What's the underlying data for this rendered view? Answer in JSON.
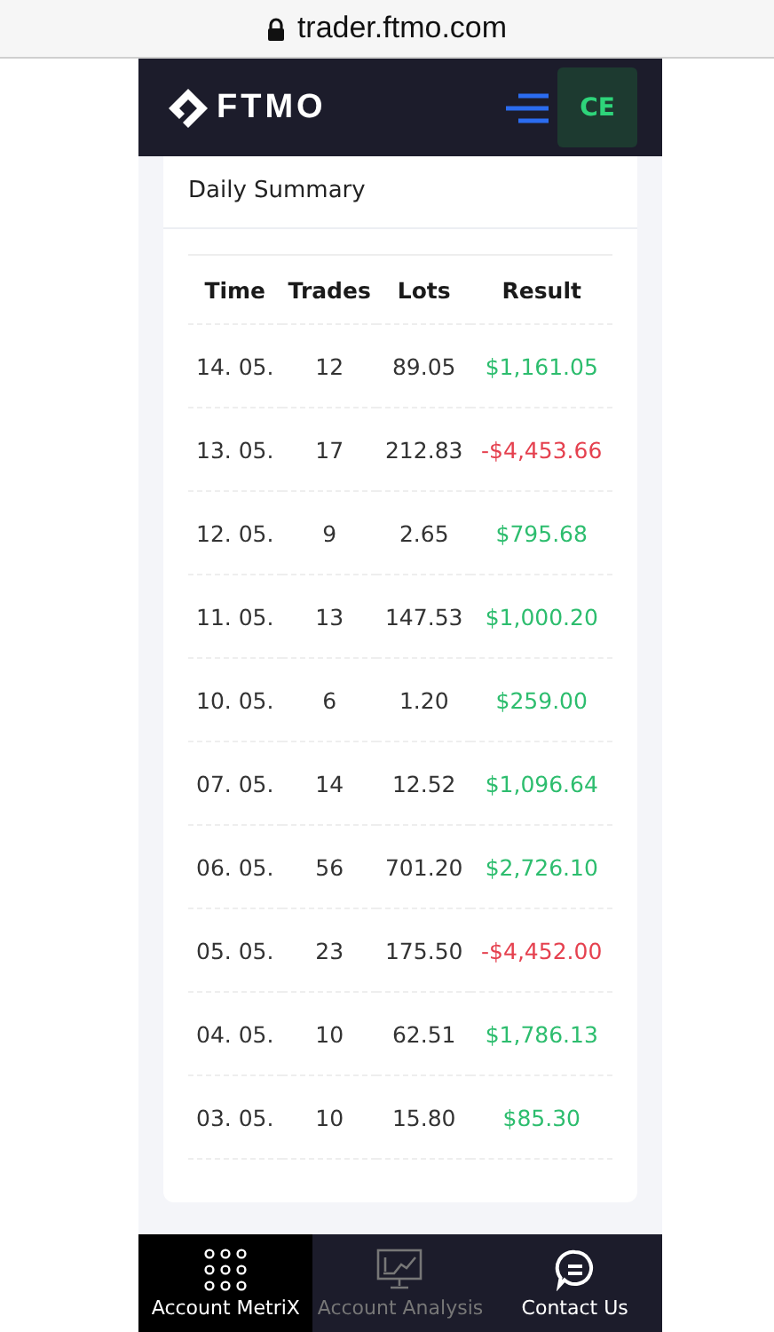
{
  "browser": {
    "url": "trader.ftmo.com"
  },
  "header": {
    "logo": "FTMO",
    "avatar": "CE"
  },
  "card": {
    "title": "Daily Summary",
    "columns": [
      "Time",
      "Trades",
      "Lots",
      "Result"
    ],
    "rows": [
      {
        "time": "14. 05.",
        "trades": "12",
        "lots": "89.05",
        "result": "$1,161.05",
        "negative": false
      },
      {
        "time": "13. 05.",
        "trades": "17",
        "lots": "212.83",
        "result": "-$4,453.66",
        "negative": true
      },
      {
        "time": "12. 05.",
        "trades": "9",
        "lots": "2.65",
        "result": "$795.68",
        "negative": false
      },
      {
        "time": "11. 05.",
        "trades": "13",
        "lots": "147.53",
        "result": "$1,000.20",
        "negative": false
      },
      {
        "time": "10. 05.",
        "trades": "6",
        "lots": "1.20",
        "result": "$259.00",
        "negative": false
      },
      {
        "time": "07. 05.",
        "trades": "14",
        "lots": "12.52",
        "result": "$1,096.64",
        "negative": false
      },
      {
        "time": "06. 05.",
        "trades": "56",
        "lots": "701.20",
        "result": "$2,726.10",
        "negative": false
      },
      {
        "time": "05. 05.",
        "trades": "23",
        "lots": "175.50",
        "result": "-$4,452.00",
        "negative": true
      },
      {
        "time": "04. 05.",
        "trades": "10",
        "lots": "62.51",
        "result": "$1,786.13",
        "negative": false
      },
      {
        "time": "03. 05.",
        "trades": "10",
        "lots": "15.80",
        "result": "$85.30",
        "negative": false
      }
    ]
  },
  "nav": [
    {
      "kind": "grid",
      "label": "Account MetriX",
      "selected": true,
      "disabled": false
    },
    {
      "kind": "monitor",
      "label": "Account Analysis",
      "selected": false,
      "disabled": true
    },
    {
      "kind": "chat",
      "label": "Contact Us",
      "selected": false,
      "disabled": false
    }
  ]
}
